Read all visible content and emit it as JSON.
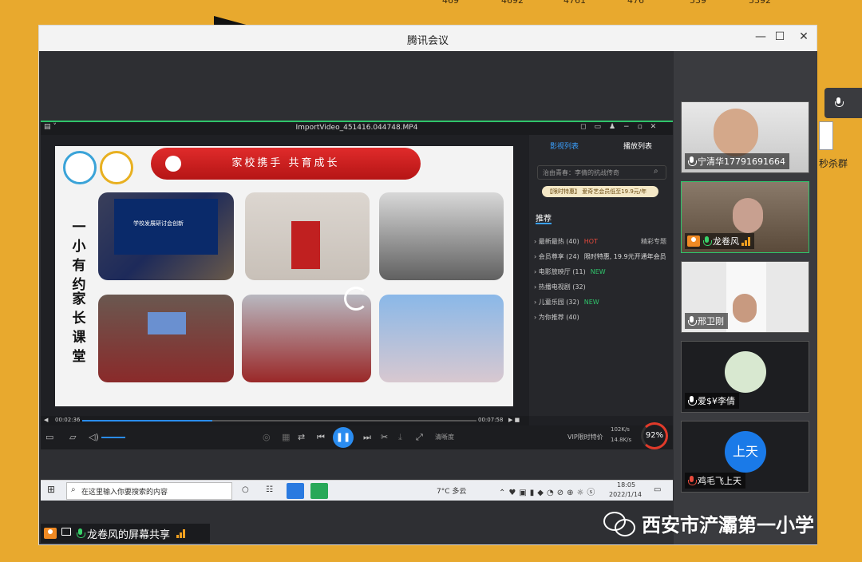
{
  "top_numbers": [
    "469",
    "4692",
    "4761",
    "476",
    "539",
    "5392"
  ],
  "window": {
    "title": "腾讯会议",
    "minimize": "—",
    "maximize": "☐",
    "close": "✕"
  },
  "player": {
    "file_name": "ImportVideo_451416.044748.MP4",
    "slide_banner": "家校携手  共育成长",
    "slide_text_left": "一小有约",
    "slide_text_right": "家长课堂",
    "photo_caption": "学校发展研讨会创新",
    "time_current": "00:02:36",
    "time_total": "00:07:58",
    "quality": "清晰度",
    "vip": "VIP限时特价",
    "speed_up": "102K/s",
    "speed_down": "14.8K/s",
    "percent": "92%",
    "progress_fraction": 0.33
  },
  "playlist": {
    "tab_active": "影视列表",
    "tab_other": "播放列表",
    "search_placeholder": "治由青春：李倩的抗战传奇",
    "promo": "【限时特惠】 爱奇艺会员低至19.9元/年",
    "section": "推荐",
    "items": [
      {
        "label": "› 最新最热 (40)",
        "tag": "HOT",
        "tag_type": "hot",
        "extra": "精彩专题"
      },
      {
        "label": "› 会员尊享 (24)",
        "tag": "限时特惠, 19.9元开通年会员",
        "tag_type": "plain",
        "extra": ""
      },
      {
        "label": "› 电影放映厅 (11)",
        "tag": "NEW",
        "tag_type": "new",
        "extra": ""
      },
      {
        "label": "› 热播电视剧 (32)",
        "tag": "",
        "tag_type": "",
        "extra": ""
      },
      {
        "label": "› 儿童乐园 (32)",
        "tag": "NEW",
        "tag_type": "new",
        "extra": ""
      },
      {
        "label": "› 为你推荐 (40)",
        "tag": "",
        "tag_type": "",
        "extra": ""
      }
    ]
  },
  "taskbar": {
    "search_placeholder": "在这里输入你要搜索的内容",
    "weather": "7°C 多云",
    "time": "18:05",
    "date": "2022/1/14"
  },
  "screen_share_label": "龙卷风的屏幕共享",
  "participants": [
    {
      "name": "宁清华17791691664",
      "mic": "normal",
      "active": false
    },
    {
      "name": "龙卷风",
      "mic": "green",
      "active": true
    },
    {
      "name": "邢卫刚",
      "mic": "normal",
      "active": false
    },
    {
      "name": "爱$¥李倩",
      "mic": "normal",
      "active": false
    },
    {
      "name": "鸡毛飞上天",
      "mic": "red",
      "active": false,
      "avatar_text": "上天"
    }
  ],
  "right_edge": {
    "group_text": "秒杀群"
  },
  "watermark": "西安市浐灞第一小学",
  "colors": {
    "background": "#e8a92e",
    "active_border": "#2fc46b",
    "play_button": "#2a8cf0",
    "banner_red": "#d42020"
  }
}
